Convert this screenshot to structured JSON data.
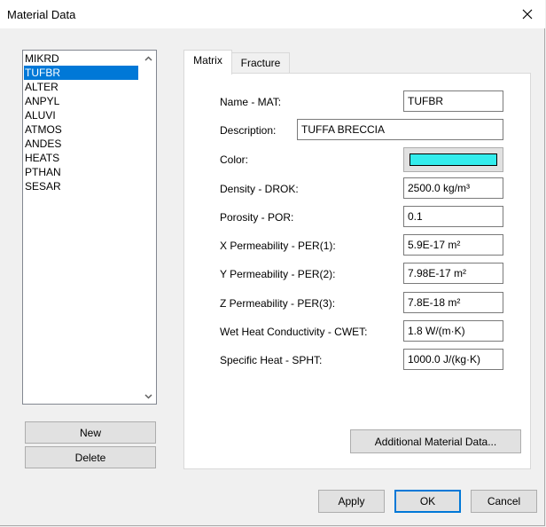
{
  "window": {
    "title": "Material Data"
  },
  "materials": {
    "items": [
      "MIKRD",
      "TUFBR",
      "ALTER",
      "ANPYL",
      "ALUVI",
      "ATMOS",
      "ANDES",
      "HEATS",
      "PTHAN",
      "SESAR"
    ],
    "selected": "TUFBR"
  },
  "list_buttons": {
    "new_label": "New",
    "delete_label": "Delete"
  },
  "tabs": [
    {
      "label": "Matrix",
      "active": true
    },
    {
      "label": "Fracture",
      "active": false
    }
  ],
  "matrix": {
    "name_label": "Name - MAT:",
    "name_value": "TUFBR",
    "description_label": "Description:",
    "description_value": "TUFFA BRECCIA",
    "color_label": "Color:",
    "color_value": "#33ecec",
    "density_label": "Density - DROK:",
    "density_value": "2500.0 kg/m³",
    "porosity_label": "Porosity - POR:",
    "porosity_value": "0.1",
    "xperm_label": "X Permeability - PER(1):",
    "xperm_value": "5.9E-17 m²",
    "yperm_label": "Y Permeability - PER(2):",
    "yperm_value": "7.98E-17 m²",
    "zperm_label": "Z Permeability - PER(3):",
    "zperm_value": "7.8E-18 m²",
    "cwet_label": "Wet Heat Conductivity - CWET:",
    "cwet_value": "1.8 W/(m·K)",
    "spht_label": "Specific Heat - SPHT:",
    "spht_value": "1000.0 J/(kg·K)",
    "additional_label": "Additional Material Data..."
  },
  "dialog_buttons": {
    "apply_label": "Apply",
    "ok_label": "OK",
    "cancel_label": "Cancel"
  },
  "icons": {
    "close": "close-icon",
    "scroll_up": "chevron-up-icon",
    "scroll_down": "chevron-down-icon"
  }
}
